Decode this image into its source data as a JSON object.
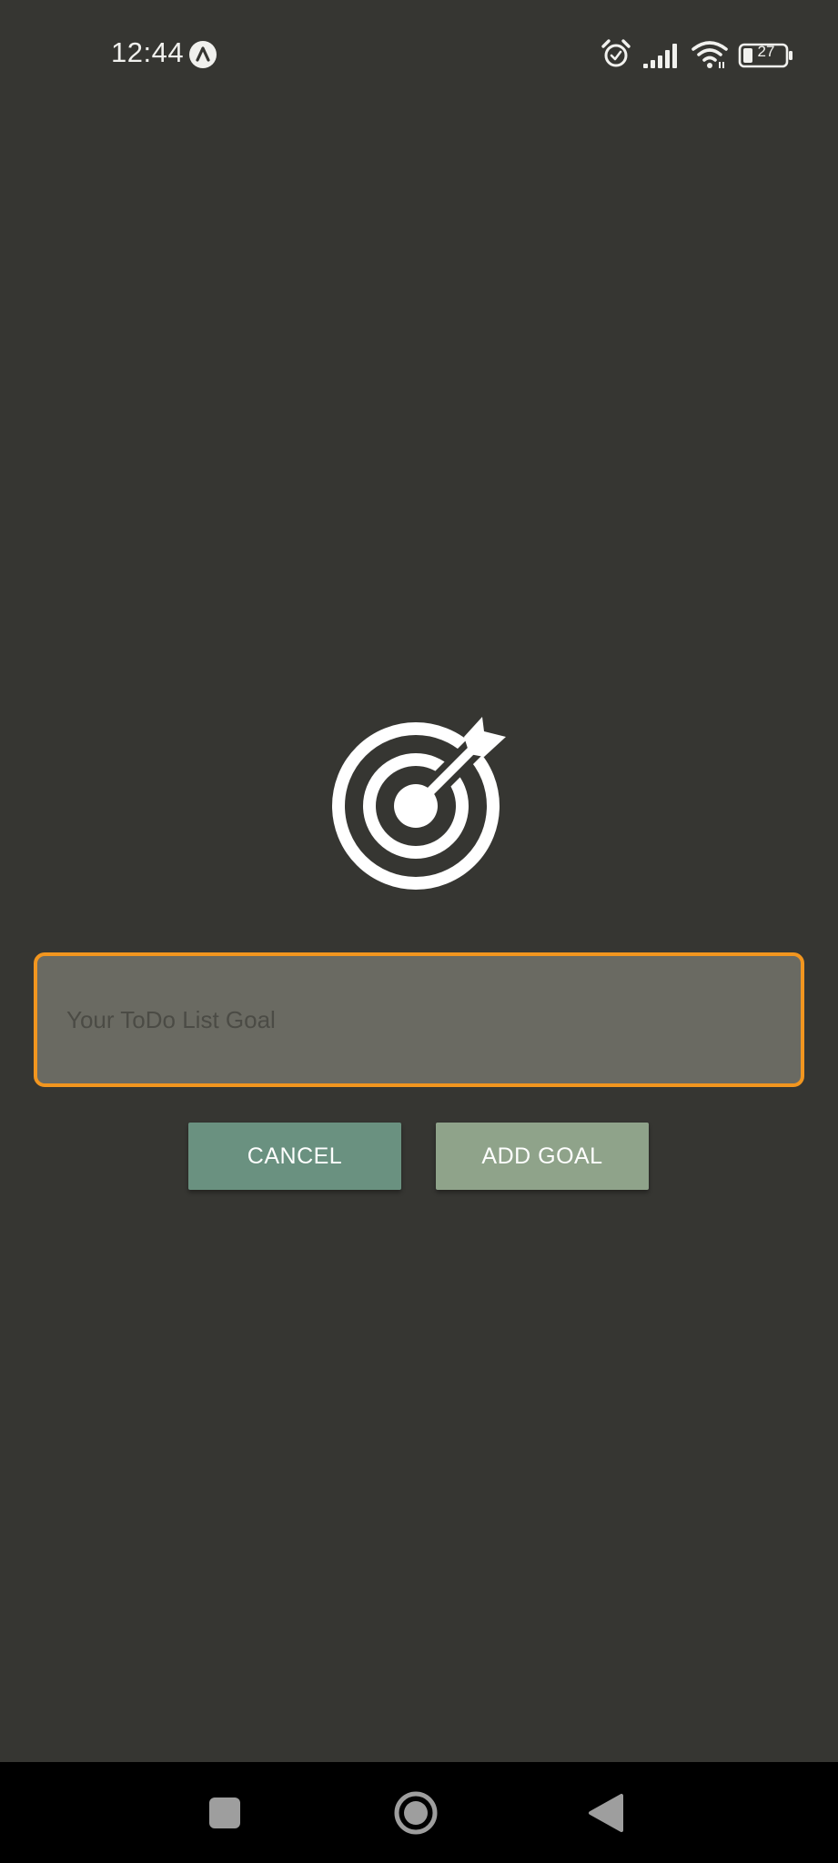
{
  "status_bar": {
    "time": "12:44",
    "battery_level": "27",
    "icons": [
      "notification-a-icon",
      "alarm-icon",
      "signal-icon",
      "wifi-icon",
      "battery-icon"
    ]
  },
  "main": {
    "icon": "target-icon",
    "goal_input": {
      "placeholder": "Your ToDo List Goal",
      "value": ""
    },
    "cancel_label": "CANCEL",
    "add_goal_label": "ADD GOAL"
  },
  "nav_bar": {
    "icons": [
      "recents-square-icon",
      "home-circle-icon",
      "back-triangle-icon"
    ]
  },
  "colors": {
    "background": "#363632",
    "input_border": "#f2961f",
    "input_background": "#6a6a62",
    "cancel_button": "#6a9180",
    "add_goal_button": "#8fa38a",
    "nav_bar": "#000000"
  }
}
